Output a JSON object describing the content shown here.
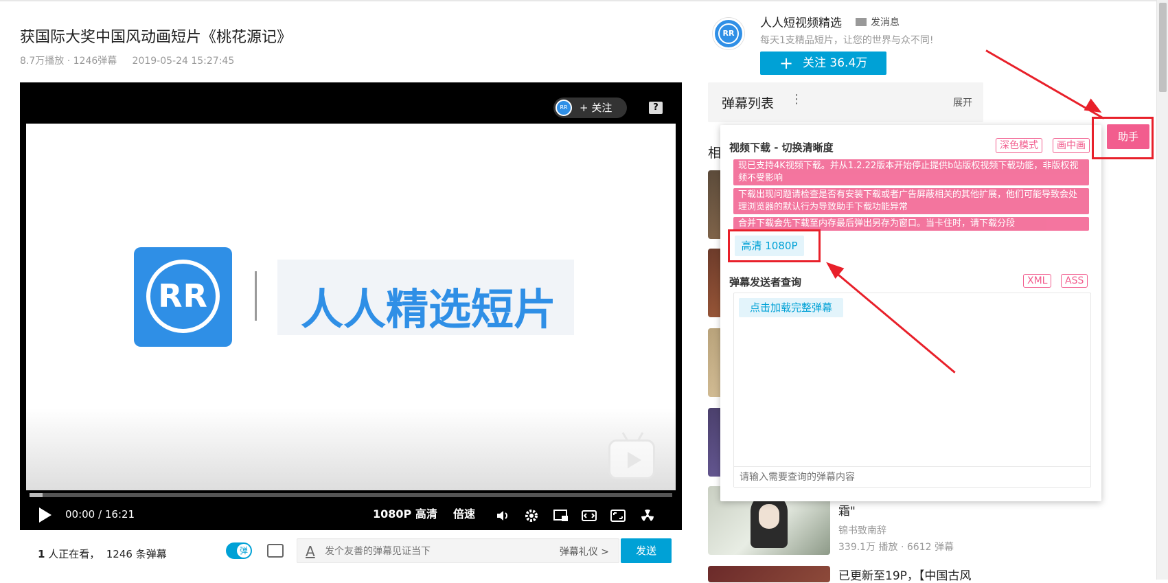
{
  "video": {
    "title": "获国际大奖中国风动画短片《桃花源记》",
    "plays": "8.7万播放",
    "separator": "·",
    "danmaku_count": "1246弹幕",
    "date": "2019-05-24 15:27:45"
  },
  "player": {
    "logo_mark": "RR",
    "logo_text": "人人精选短片",
    "follow_chip_label": "+ 关注",
    "help_icon": "?",
    "time_current": "00:00",
    "time_sep": "/",
    "time_total": "16:21",
    "quality": "1080P 高清",
    "speed": "倍速",
    "progress": 0.02,
    "icons": [
      "play-icon",
      "volume-icon",
      "settings-icon",
      "picture-in-picture-icon",
      "widescreen-icon",
      "fullscreen-icon",
      "radiation-icon"
    ]
  },
  "below_player": {
    "viewers_count": "1",
    "viewers_text": " 人正在看，",
    "danmaku_text": "1246 条弹幕",
    "toggle_label": "弹",
    "input_icon": "A",
    "input_placeholder": "发个友善的弹幕见证当下",
    "etiquette": "弹幕礼仪 >",
    "send": "发送"
  },
  "uploader": {
    "avatar": "RR",
    "name": "人人短视频精选",
    "message": "发消息",
    "desc": "每天1支精品短片，让您的世界与众不同!",
    "follow_plus": "+",
    "follow_label": "关注 36.4万"
  },
  "danmaku_list": {
    "title": "弹幕列表",
    "menu": "⋮",
    "expand": "展开"
  },
  "related": {
    "head": "相",
    "items": [
      {
        "title": "霜\"",
        "author": "锦书致南辞",
        "stats": "339.1万 播放 · 6612 弹幕"
      },
      {
        "title": "已更新至19P，【中国古风"
      }
    ]
  },
  "helper": {
    "download_title": "视频下载 - 切换清晰度",
    "dark_mode": "深色模式",
    "pip": "画中画",
    "notices": [
      "现已支持4K视频下载。并从1.2.22版本开始停止提供b站版权视频下载功能，非版权视频不受影响",
      "下载出现问题请检查是否有安装下载或者广告屏蔽相关的其他扩展，他们可能导致会处理浏览器的默认行为导致助手下载功能异常",
      "合并下载会先下载至内存最后弹出另存为窗口。当卡住时，请下载分段"
    ],
    "quality_option": "高清 1080P",
    "query_title": "弹幕发送者查询",
    "xml": "XML",
    "ass": "ASS",
    "load_full": "点击加载完整弹幕",
    "query_placeholder": "请输入需要查询的弹幕内容"
  },
  "assistant_button": "助手",
  "colors": {
    "accent_blue": "#00a1d6",
    "pink": "#f25d8e",
    "annotation_red": "#e8202a",
    "logo_blue": "#2f8fe6"
  }
}
